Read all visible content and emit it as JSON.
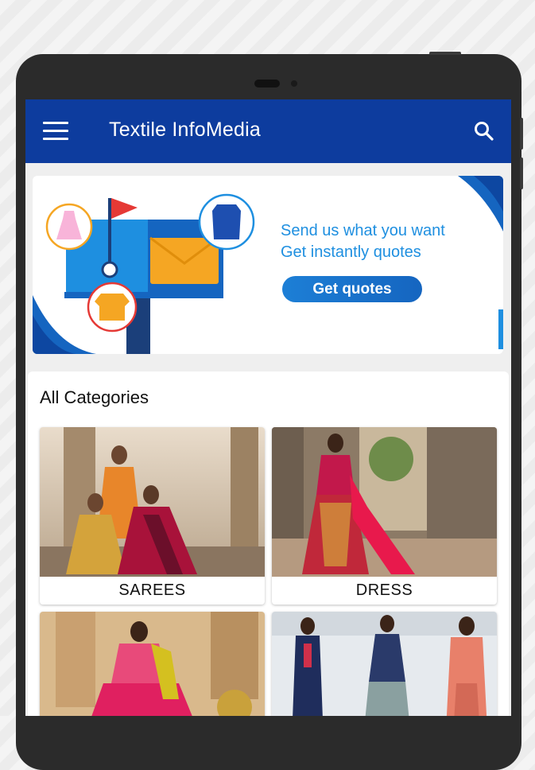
{
  "app": {
    "title": "Textile InfoMedia"
  },
  "icons": {
    "menu": "menu-icon",
    "search": "search-icon"
  },
  "colors": {
    "appbar": "#0d3c9e",
    "accent": "#1e8fe0"
  },
  "banner": {
    "line1": "Send us what you want",
    "line2": "Get instantly quotes",
    "button_label": "Get quotes"
  },
  "categories": {
    "heading": "All Categories",
    "items": [
      {
        "label": "SAREES"
      },
      {
        "label": "DRESS"
      },
      {
        "label": ""
      },
      {
        "label": ""
      }
    ]
  }
}
